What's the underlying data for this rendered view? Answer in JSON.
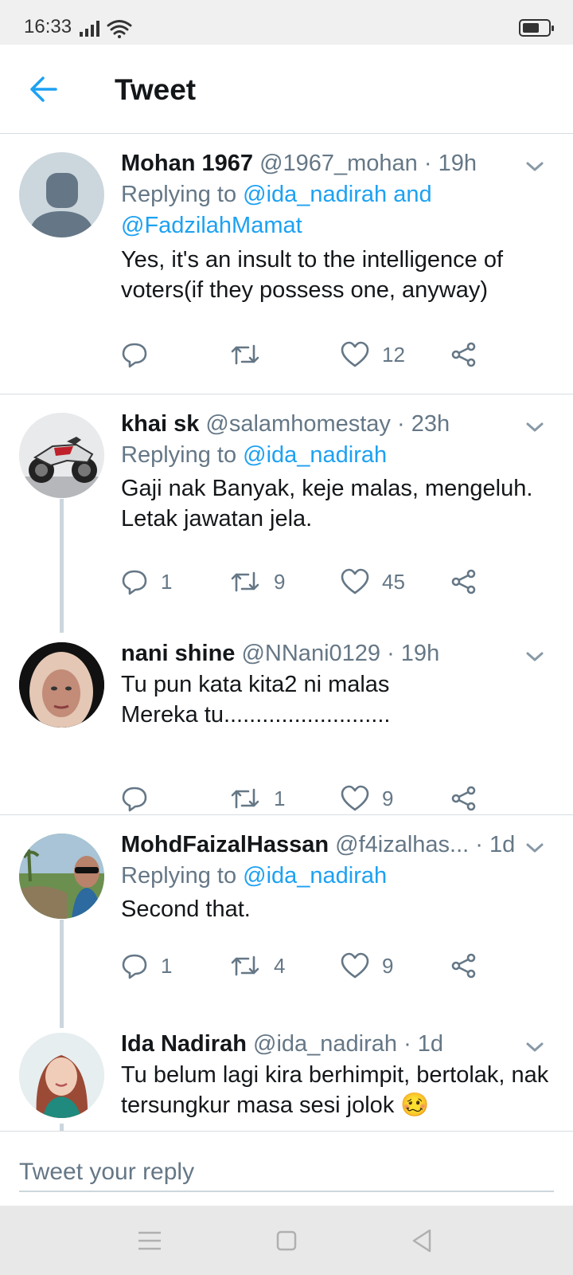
{
  "status_bar": {
    "time": "16:33"
  },
  "header": {
    "title": "Tweet"
  },
  "tweets": [
    {
      "name": "Mohan 1967",
      "handle": "@1967_mohan",
      "time": "· 19h",
      "replying_prefix": "Replying to ",
      "replying_mentions": "@ida_nadirah and @FadzilahMamat",
      "text": "Yes, it's an insult to the intelligence of voters(if they possess one, anyway)",
      "reply_count": "",
      "retweet_count": "",
      "like_count": "12"
    },
    {
      "name": "khai sk",
      "handle": "@salamhomestay",
      "time": "· 23h",
      "replying_prefix": "Replying to ",
      "replying_mentions": "@ida_nadirah",
      "text": "Gaji nak Banyak, keje malas, mengeluh. Letak jawatan jela.",
      "reply_count": "1",
      "retweet_count": "9",
      "like_count": "45"
    },
    {
      "name": "nani shine",
      "handle": "@NNani0129",
      "time": "· 19h",
      "text_line1": "Tu pun kata kita2 ni malas",
      "text_line2": "Mereka tu..........................",
      "reply_count": "",
      "retweet_count": "1",
      "like_count": "9"
    },
    {
      "name": "MohdFaizalHassan",
      "handle": "@f4izalhas...",
      "time": "· 1d",
      "replying_prefix": "Replying to ",
      "replying_mentions": "@ida_nadirah",
      "text": "Second that.",
      "reply_count": "1",
      "retweet_count": "4",
      "like_count": "9"
    },
    {
      "name": "Ida Nadirah",
      "handle": "@ida_nadirah",
      "time": "· 1d",
      "text": "Tu belum lagi kira berhimpit, bertolak, nak tersungkur masa sesi jolok 🥴"
    }
  ],
  "reply_box": {
    "placeholder": "Tweet your reply"
  },
  "colors": {
    "accent": "#1da1f2",
    "secondary_text": "#657786",
    "divider": "#d7dde2"
  },
  "icons": [
    "back-arrow-icon",
    "caret-down-icon",
    "reply-icon",
    "retweet-icon",
    "like-icon",
    "share-icon",
    "signal-icon",
    "wifi-icon",
    "battery-icon",
    "menu-icon",
    "home-icon",
    "back-triangle-icon"
  ]
}
